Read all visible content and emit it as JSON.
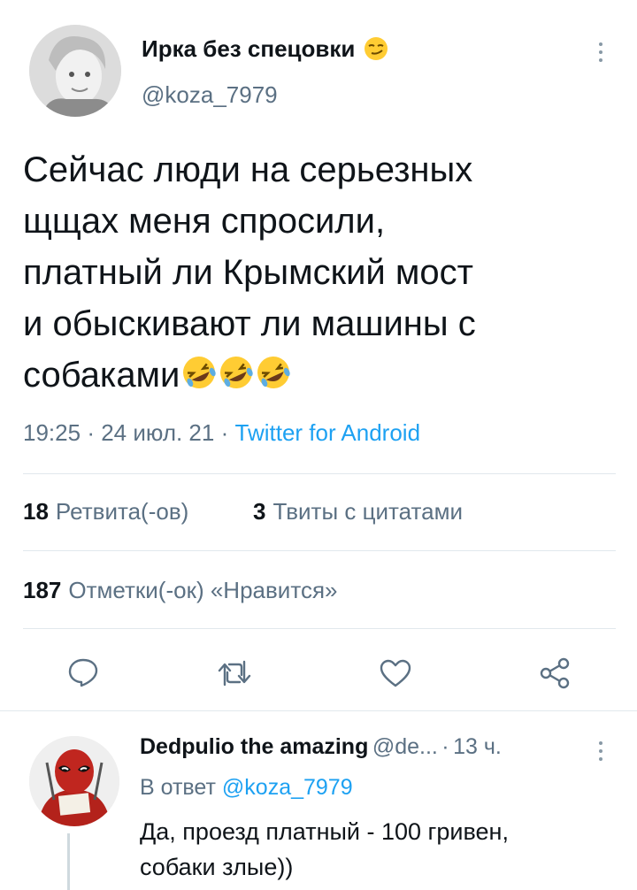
{
  "tweet": {
    "author_name": "Ирка без спецовки",
    "author_emoji": "smirking-face",
    "handle": "@koza_7979",
    "text_lines": [
      "Сейчас люди на серьезных",
      "щщах меня спросили,",
      "платный ли Крымский мост",
      "и обыскивают ли машины с",
      "собаками"
    ],
    "text_emojis": [
      "rofl-emoji",
      "rofl-emoji",
      "rofl-emoji"
    ],
    "time": "19:25",
    "date": "24 июл. 21",
    "separator": "·",
    "app": "Twitter for Android"
  },
  "stats": {
    "retweets_count": "18",
    "retweets_label": "Ретвита(-ов)",
    "quotes_count": "3",
    "quotes_label": "Твиты с цитатами",
    "likes_count": "187",
    "likes_label": "Отметки(-ок) «Нравится»"
  },
  "actions": [
    "reply-icon",
    "retweet-icon",
    "like-icon",
    "share-icon"
  ],
  "reply": {
    "author_name": "Dedpulio the amazing",
    "handle": "@de...",
    "separator": "·",
    "time": "13 ч.",
    "reply_to_prefix": "В ответ",
    "reply_to_handle": "@koza_7979",
    "text_lines": [
      "Да, проезд платный - 100 гривен,",
      "собаки злые))"
    ]
  },
  "colors": {
    "accent": "#1da1f2",
    "secondary_text": "#5b7083",
    "divider": "#e1e8ed",
    "deadpool_red": "#c0261f"
  }
}
